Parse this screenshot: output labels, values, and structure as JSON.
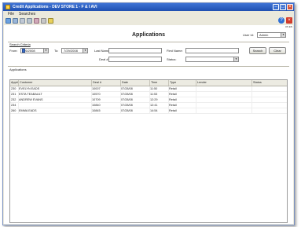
{
  "window": {
    "title": "Credit Applications - DEV STORE 1 - F & I AVI"
  },
  "menu": {
    "items": [
      "File",
      "Searches"
    ]
  },
  "header": {
    "page_title": "Applications",
    "user_id_label": "User Id:",
    "user_id_value": "Admin"
  },
  "locale": "US EN",
  "search": {
    "section_label": "Search Criteria",
    "from_label": "From:",
    "from_value": "7/6/2008",
    "to_label": "To:",
    "to_value": "7/29/2008",
    "last_name_label": "Last Name:",
    "last_name_value": "",
    "first_name_label": "First Name:",
    "first_name_value": "",
    "deal_label": "Deal #:",
    "deal_value": "",
    "status_label": "Status:",
    "status_value": "",
    "search_button": "Search",
    "clear_button": "Clear"
  },
  "applications": {
    "section_label": "Applications",
    "columns": [
      "App#",
      "Customer",
      "Deal #",
      "Date",
      "Time",
      "Type",
      "Lender",
      "Status"
    ],
    "rows": [
      [
        "230",
        "EVELYN EADS",
        "10007",
        "07/28/08",
        "11:50",
        "Retail",
        "",
        ""
      ],
      [
        "231",
        "ESTA TEABAULT",
        "10570",
        "07/28/08",
        "11:53",
        "Retail",
        "",
        ""
      ],
      [
        "232",
        "ANDREW EVANS",
        "10709",
        "07/28/08",
        "12:29",
        "Retail",
        "",
        ""
      ],
      [
        "234",
        "",
        "10840",
        "07/28/08",
        "12:41",
        "Retail",
        "",
        ""
      ],
      [
        "260",
        "EMMA EADS",
        "10845",
        "07/28/08",
        "14:54",
        "Retail",
        "",
        ""
      ]
    ]
  },
  "colors": {
    "titlebar": "#2a5cc0",
    "window_bg": "#ebe9dc",
    "close": "#d23a2a"
  }
}
